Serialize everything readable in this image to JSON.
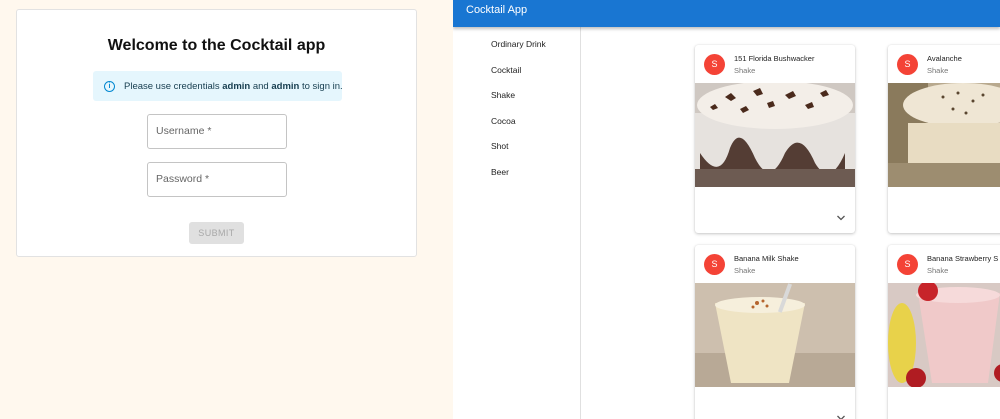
{
  "login": {
    "title": "Welcome to the Cocktail app",
    "alert": {
      "icon": "info-icon",
      "prefix": "Please use credentials ",
      "user": "admin",
      "middle": " and ",
      "pass": "admin",
      "suffix": " to sign in."
    },
    "username_label": "Username *",
    "password_label": "Password *",
    "submit_label": "SUBMIT"
  },
  "app": {
    "title": "Cocktail App",
    "accent": "#1976d2",
    "avatar_color": "#f44336",
    "categories": [
      "Ordinary Drink",
      "Cocktail",
      "Shake",
      "Cocoa",
      "Shot",
      "Beer"
    ],
    "cards": [
      {
        "avatar": "S",
        "name": "151 Florida Bushwacker",
        "category": "Shake"
      },
      {
        "avatar": "S",
        "name": "Avalanche",
        "category": "Shake"
      },
      {
        "avatar": "S",
        "name": "Banana Milk Shake",
        "category": "Shake"
      },
      {
        "avatar": "S",
        "name": "Banana Strawberry S",
        "category": "Shake"
      }
    ]
  }
}
